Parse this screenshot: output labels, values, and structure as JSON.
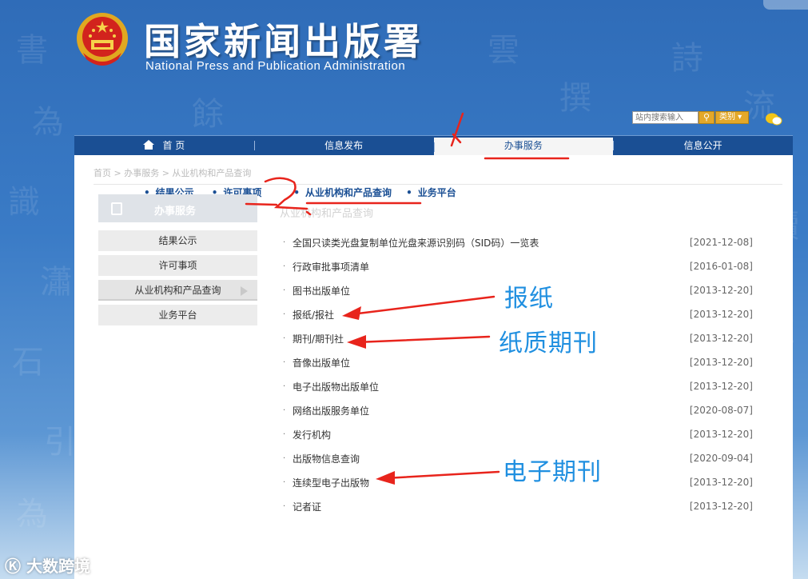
{
  "header": {
    "title_cn": "国家新闻出版署",
    "title_en": "National  Press and Publication Administration",
    "search_placeholder": "站内搜索输入",
    "category_label": "类别"
  },
  "nav": [
    {
      "label": "首 页",
      "icon": "home-icon"
    },
    {
      "label": "信息发布"
    },
    {
      "label": "办事服务",
      "active": true
    },
    {
      "label": "信息公开"
    }
  ],
  "breadcrumb": "首页 > 办事服务 > 从业机构和产品查询",
  "subnav": [
    "结果公示",
    "许可事项",
    "从业机构和产品查询",
    "业务平台"
  ],
  "sidebar": {
    "heading": "办事服务",
    "items": [
      "结果公示",
      "许可事项",
      "从业机构和产品查询",
      "业务平台"
    ],
    "active_index": 2
  },
  "section_title": "从业机构和产品查询",
  "list": [
    {
      "title": "全国只读类光盘复制单位光盘来源识别码（SID码）一览表",
      "date": "[2021-12-08]"
    },
    {
      "title": "行政审批事项清单",
      "date": "[2016-01-08]"
    },
    {
      "title": "图书出版单位",
      "date": "[2013-12-20]"
    },
    {
      "title": "报纸/报社",
      "date": "[2013-12-20]"
    },
    {
      "title": "期刊/期刊社",
      "date": "[2013-12-20]"
    },
    {
      "title": "音像出版单位",
      "date": "[2013-12-20]"
    },
    {
      "title": "电子出版物出版单位",
      "date": "[2013-12-20]"
    },
    {
      "title": "网络出版服务单位",
      "date": "[2020-08-07]"
    },
    {
      "title": "发行机构",
      "date": "[2013-12-20]"
    },
    {
      "title": "出版物信息查询",
      "date": "[2020-09-04]"
    },
    {
      "title": "连续型电子出版物",
      "date": "[2013-12-20]"
    },
    {
      "title": "记者证",
      "date": "[2013-12-20]"
    }
  ],
  "annotations": {
    "newspaper": "报纸",
    "print_journal": "纸质期刊",
    "e_journal": "电子期刊",
    "color": "#1f8fe0",
    "arrow_color": "#e8241c"
  },
  "watermark": "大数跨境",
  "colors": {
    "nav_bg": "#1a4f94",
    "accent": "#e3a82a"
  }
}
